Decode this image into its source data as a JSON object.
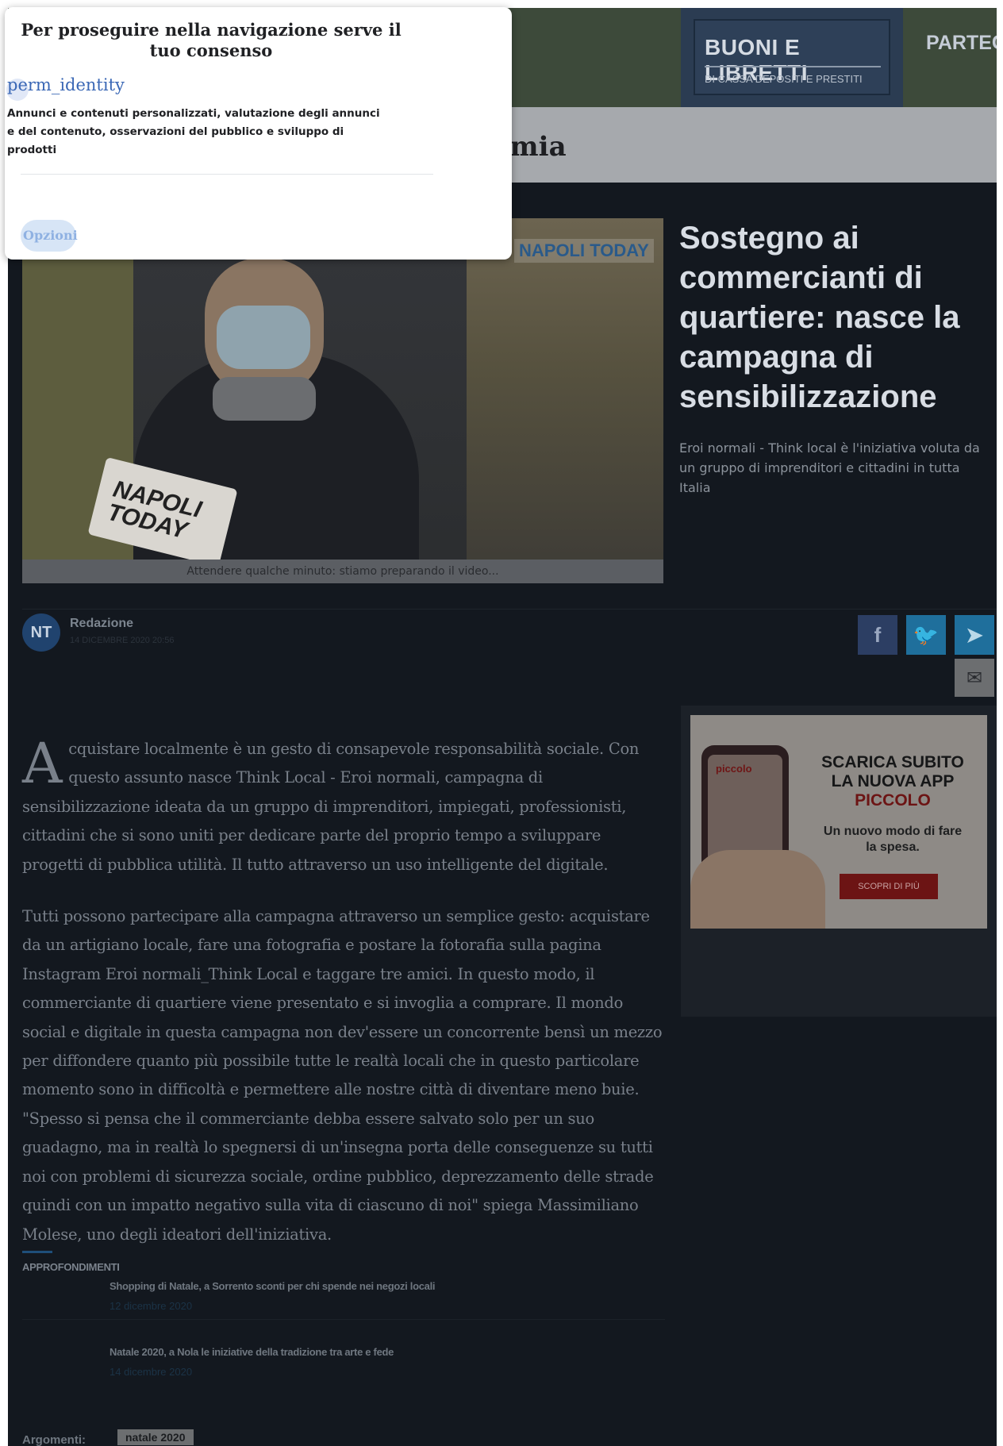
{
  "header": {
    "ad_title": "BUONI E LIBRETTI",
    "ad_subtitle": "DI CASSA DEPOSITI E PRESTITI",
    "nav_item": "PARTEC"
  },
  "section": {
    "title": "omia"
  },
  "video": {
    "logo": "NAPOLI TODAY",
    "mic_text": "NAPOLI TODAY",
    "caption": "Attendere qualche minuto: stiamo preparando il video..."
  },
  "article": {
    "headline": "Sostegno ai commercianti di quartiere: nasce la campagna di sensibilizzazione",
    "subheadline": "Eroi normali - Think local è l'iniziativa voluta da un gruppo di imprenditori e cittadini in tutta Italia",
    "author": {
      "initials": "NT",
      "name": "Redazione",
      "date": "14 DICEMBRE 2020 20:56"
    },
    "dropcap": "A",
    "paragraph1": "cquistare localmente è un gesto di consapevole responsabilità sociale. Con questo assunto nasce Think Local - Eroi normali, campagna di sensibilizzazione ideata da un gruppo di imprenditori, impiegati, professionisti, cittadini che si sono uniti per dedicare parte del proprio tempo a sviluppare progetti di pubblica utilità. Il tutto attraverso un uso intelligente del digitale.",
    "paragraph2": "Tutti possono partecipare alla campagna attraverso un semplice gesto: acquistare da un artigiano locale, fare una fotografia e postare la fotorafia sulla pagina Instagram Eroi normali_Think Local e taggare tre amici. In questo modo, il commerciante di quartiere viene presentato e si invoglia a comprare. Il mondo social e digitale in questa campagna non dev'essere un concorrente bensì un mezzo per diffondere quanto più possibile tutte le realtà locali che in questo particolare momento sono in difficoltà e permettere alle nostre città di diventare meno buie. \"Spesso si pensa che il commerciante debba essere salvato solo per un suo guadagno, ma in realtà lo spegnersi di un'insegna porta delle conseguenze su tutti noi con problemi di sicurezza sociale, ordine pubblico, deprezzamento delle strade quindi con un impatto negativo sulla vita di ciascuno di noi\" spiega Massimiliano Molese, uno degli ideatori dell'iniziativa."
  },
  "share": {
    "facebook": "f",
    "twitter": "🐦",
    "telegram": "➤",
    "mail": "✉"
  },
  "ad": {
    "brand": "piccolo",
    "title_line1": "SCARICA SUBITO",
    "title_line2": "LA NUOVA APP",
    "title_line3": "PICCOLO",
    "subtitle": "Un nuovo modo di fare la spesa.",
    "button": "SCOPRI DI PIÙ"
  },
  "related": {
    "heading": "APPROFONDIMENTI",
    "items": [
      {
        "title": "Shopping di Natale, a Sorrento sconti per chi spende nei negozi locali",
        "date": "12 dicembre 2020"
      },
      {
        "title": "Natale 2020, a Nola le iniziative della tradizione tra arte e fede",
        "date": "14 dicembre 2020"
      }
    ]
  },
  "tags": {
    "label": "Argomenti:",
    "tag": "natale 2020"
  },
  "consent": {
    "title": "Per proseguire nella navigazione serve il tuo consenso",
    "icon_name": "perm_identity",
    "purposes": "Annunci e contenuti personalizzati, valutazione degli annunci e del contenuto, osservazioni del pubblico e sviluppo di prodotti",
    "options_label": "Opzioni"
  }
}
